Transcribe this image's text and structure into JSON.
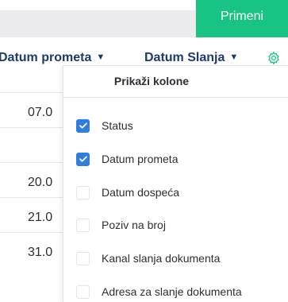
{
  "toolbar": {
    "apply_label": "Primeni"
  },
  "table": {
    "headers": [
      {
        "label": "Datum prometa"
      },
      {
        "label": "Datum Slanja"
      }
    ],
    "rows": [
      "07.0",
      "",
      "20.0",
      "21.0",
      "31.0"
    ]
  },
  "column_picker": {
    "title": "Prikaži kolone",
    "options": [
      {
        "label": "Status",
        "checked": true
      },
      {
        "label": "Datum prometa",
        "checked": true
      },
      {
        "label": "Datum dospeća",
        "checked": false
      },
      {
        "label": "Poziv na broj",
        "checked": false
      },
      {
        "label": "Kanal slanja dokumenta",
        "checked": false
      },
      {
        "label": "Adresa za slanje dokumenta",
        "checked": false
      }
    ]
  },
  "colors": {
    "accent_green": "#17c484",
    "checkbox_blue": "#2f7de1",
    "header_text": "#1d3a6e",
    "gear_icon": "#1fc48e"
  },
  "icons": {
    "settings": "gear-icon",
    "sort": "chevron-down-icon",
    "check": "check-icon"
  }
}
